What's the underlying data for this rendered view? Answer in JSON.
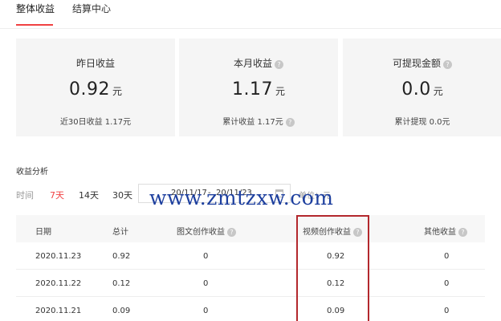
{
  "tabs": [
    {
      "label": "整体收益",
      "active": true
    },
    {
      "label": "结算中心",
      "active": false
    }
  ],
  "cards": [
    {
      "label": "昨日收益",
      "has_help": false,
      "value": "0.92",
      "unit": "元",
      "sub": "近30日收益 1.17元"
    },
    {
      "label": "本月收益",
      "has_help": true,
      "value": "1.17",
      "unit": "元",
      "sub": "累计收益 1.17元"
    },
    {
      "label": "可提现金额",
      "has_help": true,
      "value": "0.0",
      "unit": "元",
      "sub": "累计提现 0.0元"
    }
  ],
  "analysis": {
    "title": "收益分析",
    "time_label": "时间",
    "ranges": [
      {
        "label": "7天",
        "active": true
      },
      {
        "label": "14天",
        "active": false
      },
      {
        "label": "30天",
        "active": false
      }
    ],
    "date_start": "20/11/17",
    "date_sep": "-",
    "date_end": "20/11/23",
    "unit_label": "单位：元"
  },
  "table": {
    "headers": [
      "日期",
      "总计",
      "图文创作收益",
      "视频创作收益",
      "其他收益"
    ],
    "header_help": [
      false,
      false,
      true,
      true,
      true
    ],
    "rows": [
      [
        "2020.11.23",
        "0.92",
        "0",
        "0.92",
        "0"
      ],
      [
        "2020.11.22",
        "0.12",
        "0",
        "0.12",
        "0"
      ],
      [
        "2020.11.21",
        "0.09",
        "0",
        "0.09",
        "0"
      ]
    ]
  },
  "watermark": "www.zmtzxw.com",
  "colors": {
    "accent": "#f04142",
    "highlight_box": "#b3282d",
    "watermark": "#1d3f9e",
    "card_bg": "#f5f5f5"
  }
}
